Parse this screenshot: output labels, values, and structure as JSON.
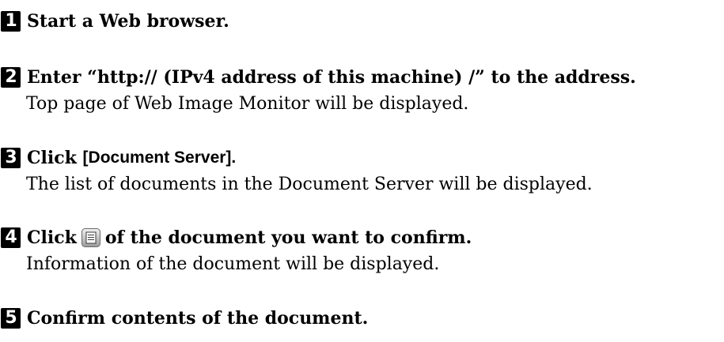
{
  "steps": [
    {
      "number": "1",
      "title": "Start a Web browser."
    },
    {
      "number": "2",
      "title": "Enter “http:// (IPv4 address of this machine) /” to the address.",
      "description": "Top page of Web Image Monitor will be displayed."
    },
    {
      "number": "3",
      "title_prefix": "Click ",
      "ui_label": "[Document Server].",
      "description": "The list of documents in the Document Server will be displayed."
    },
    {
      "number": "4",
      "title_prefix": "Click",
      "icon": "document-details-icon",
      "title_suffix": "of the document you want to confirm.",
      "description": "Information of the document will be displayed."
    },
    {
      "number": "5",
      "title": "Confirm contents of the document."
    }
  ]
}
